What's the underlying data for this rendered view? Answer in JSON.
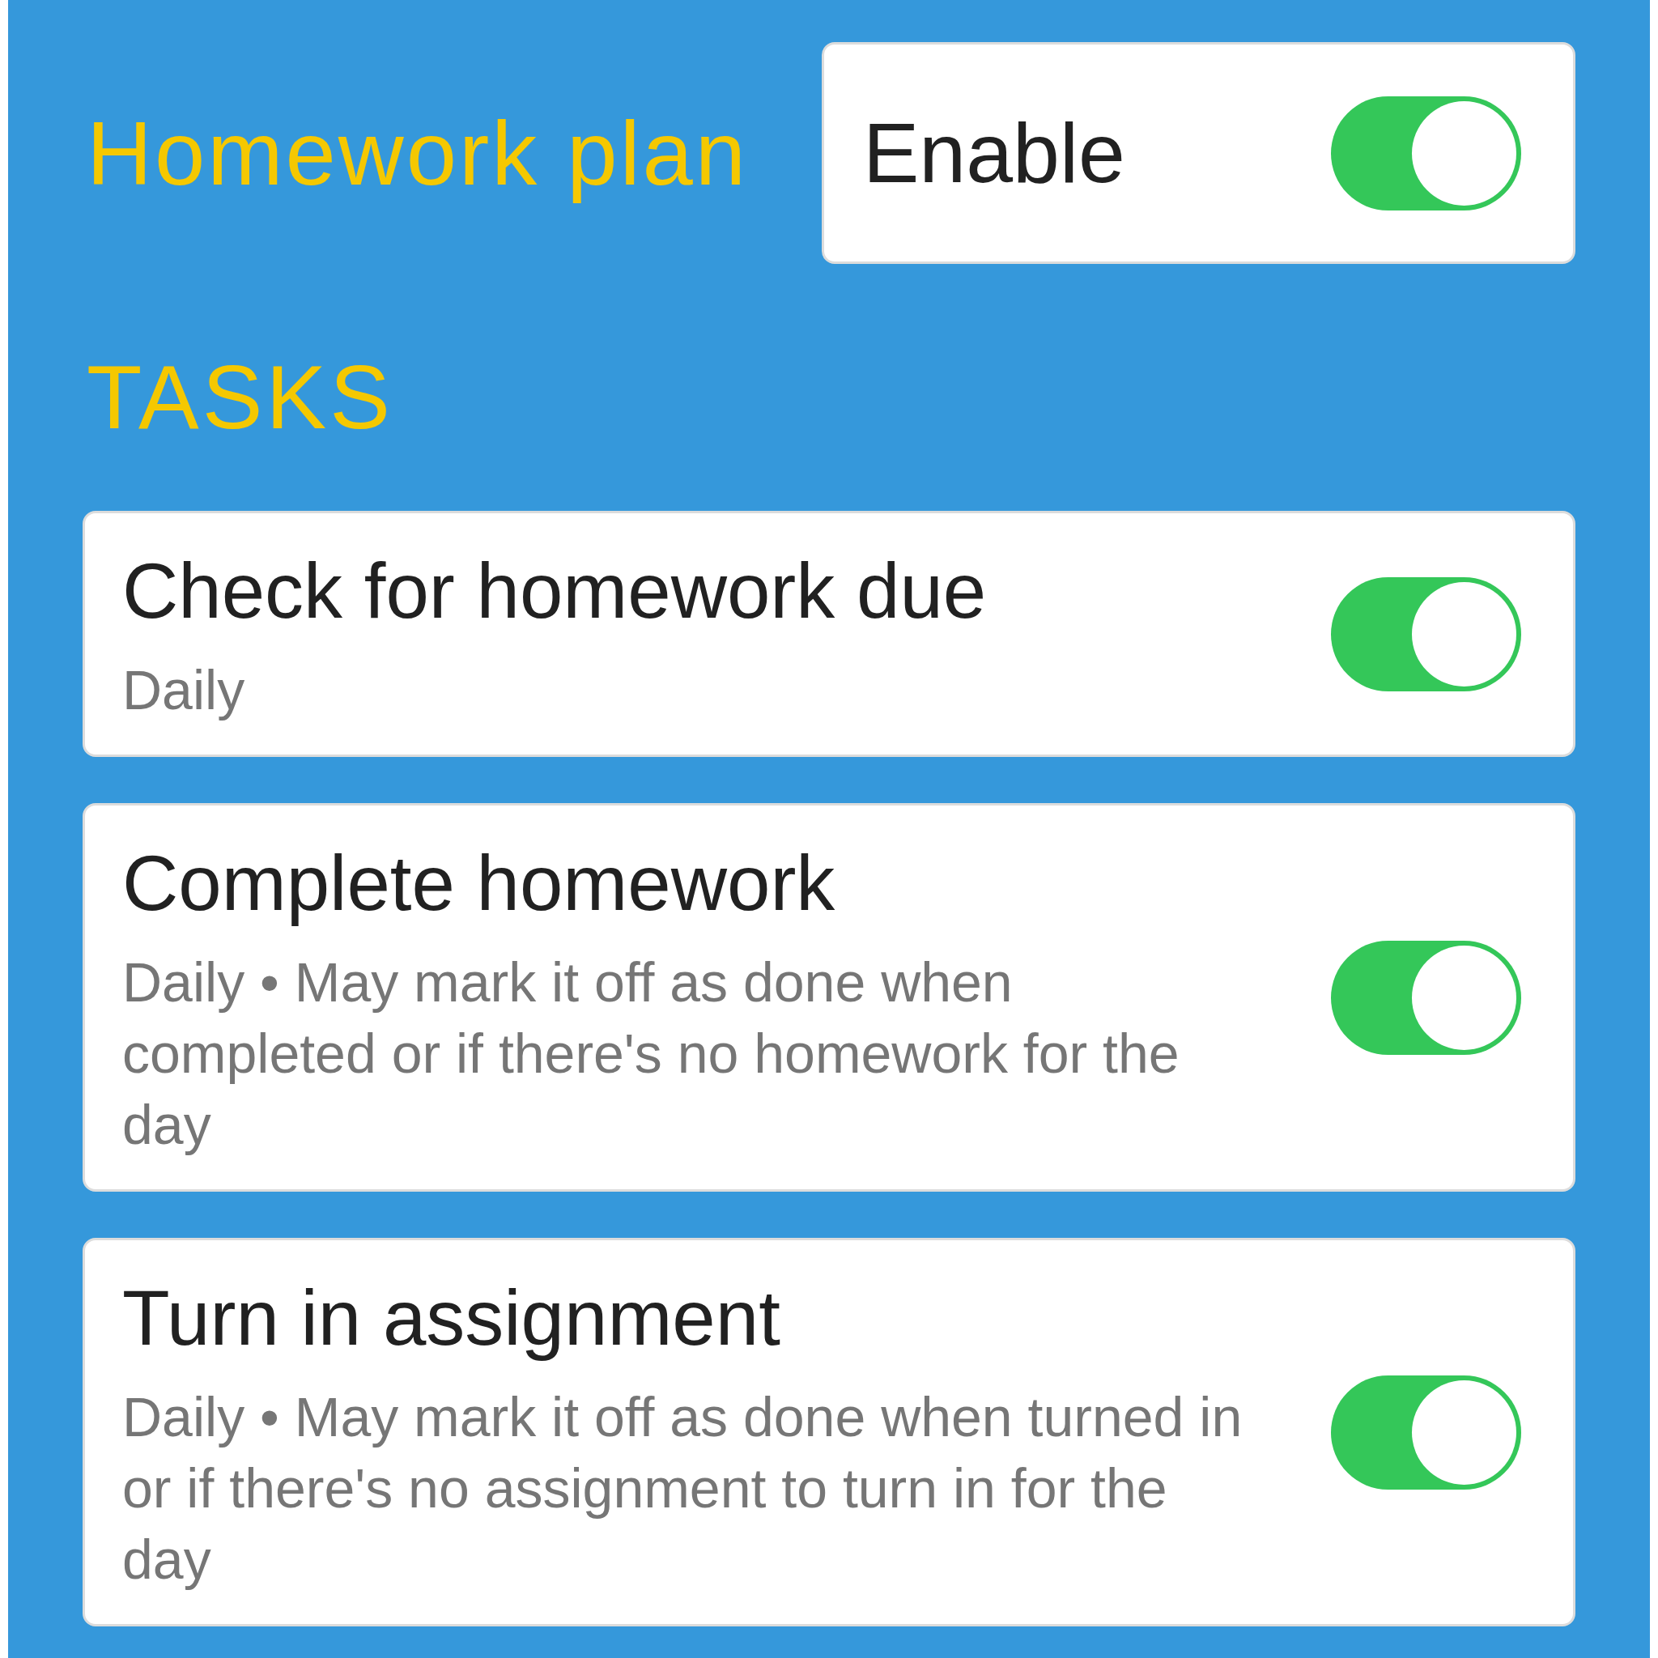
{
  "header": {
    "title": "Homework plan",
    "enable": {
      "label": "Enable",
      "on": true
    }
  },
  "section_title": "TASKS",
  "tasks": [
    {
      "title": "Check for homework due",
      "subtitle": "Daily",
      "on": true
    },
    {
      "title": "Complete homework",
      "subtitle": "Daily • May mark it off as done when completed or if there's no homework for the day",
      "on": true
    },
    {
      "title": "Turn in assignment",
      "subtitle": "Daily • May mark it off as done when turned in or if there's no assignment to turn in for the day",
      "on": true
    }
  ]
}
